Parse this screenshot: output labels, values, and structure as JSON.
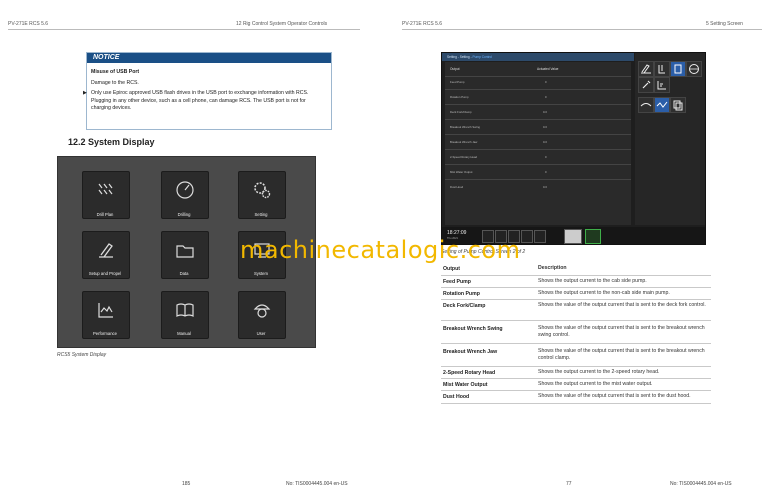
{
  "header": {
    "left_doc": "PV-271E RCS 5.6",
    "left_section": "12 Rig Control System Operator Controls",
    "right_doc": "PV-271E RCS 5.6",
    "right_section": "5 Setting Screen"
  },
  "notice": {
    "title": "NOTICE",
    "heading": "Misuse of USB Port",
    "consequence": "Damage to the RCS.",
    "bullet": "▶",
    "instruction": "Only use Epiroc approved USB flash drives in the USB port to exchange information with RCS. Plugging in any other device, such as a cell phone, can damage RCS. The USB port is not for charging devices."
  },
  "section": {
    "title": "12.2  System Display"
  },
  "rcs_display": {
    "caption": "RCS5 System Display",
    "tiles": [
      {
        "label": "Drill Plan",
        "icon": "drill-plan-icon"
      },
      {
        "label": "Drilling",
        "icon": "gauge-icon"
      },
      {
        "label": "Setting",
        "icon": "gear-icon"
      },
      {
        "label": "Setup and Propel",
        "icon": "rig-icon"
      },
      {
        "label": "Data",
        "icon": "folder-icon"
      },
      {
        "label": "System",
        "icon": "system-icon"
      },
      {
        "label": "Performance",
        "icon": "chart-icon"
      },
      {
        "label": "Manual",
        "icon": "book-icon"
      },
      {
        "label": "User",
        "icon": "helmet-icon"
      }
    ]
  },
  "screen": {
    "breadcrumb": "Setting - Setting - ",
    "breadcrumb_active": "Pump Control",
    "col_output": "Output",
    "col_value": "Actuated Value",
    "rows": [
      {
        "name": "Feed Pump",
        "value": "0"
      },
      {
        "name": "Rotation Pump",
        "value": "0"
      },
      {
        "name": "Deck Fork/Clamp",
        "value": "0.0"
      },
      {
        "name": "Breakout Wrench Swing",
        "value": "0.0"
      },
      {
        "name": "Breakout Wrench Jaw",
        "value": "0.0"
      },
      {
        "name": "2-Speed Rotary Head",
        "value": "0"
      },
      {
        "name": "Mist Water Output",
        "value": "0"
      },
      {
        "name": "Dust Hood",
        "value": "0.0"
      }
    ],
    "clock": "18:27:09",
    "date": "Thu 2021",
    "caption": "Setting of Pump Control Screen 2 of 2"
  },
  "output_table": {
    "col_output": "Output",
    "col_description": "Description",
    "rows": [
      {
        "output": "Feed Pump",
        "description": "Shows the output current to the cab side pump."
      },
      {
        "output": "Rotation Pump",
        "description": "Shows the output current to the non-cab side main pump."
      },
      {
        "output": "Deck Fork/Clamp",
        "description": "Shows the value of the output current that is sent to the deck fork control."
      },
      {
        "output": "Breakout Wrench Swing",
        "description": "Shows the value of the output current that is sent to the breakout wrench swing control."
      },
      {
        "output": "Breakout Wrench Jaw",
        "description": "Shows the value of the output current that is sent to the breakout wrench control clamp."
      },
      {
        "output": "2-Speed Rotary Head",
        "description": "Shows the output current to the 2-speed rotary head."
      },
      {
        "output": "Mist Water Output",
        "description": "Shows the output current to the mist water output."
      },
      {
        "output": "Dust Hood",
        "description": "Shows the value of the output current that is sent to the dust hood."
      }
    ]
  },
  "footer": {
    "left_page": "185",
    "left_doc_no": "No: TIS0004445.004 en-US",
    "right_page": "77",
    "right_doc_no": "No: TIS0004445.004 en-US"
  },
  "watermark": "machinecatalogic.com",
  "colors": {
    "notice_blue": "#1a4f86",
    "watermark": "#f2b800",
    "active_blue": "#2b5ea8",
    "green": "#3fae49"
  }
}
